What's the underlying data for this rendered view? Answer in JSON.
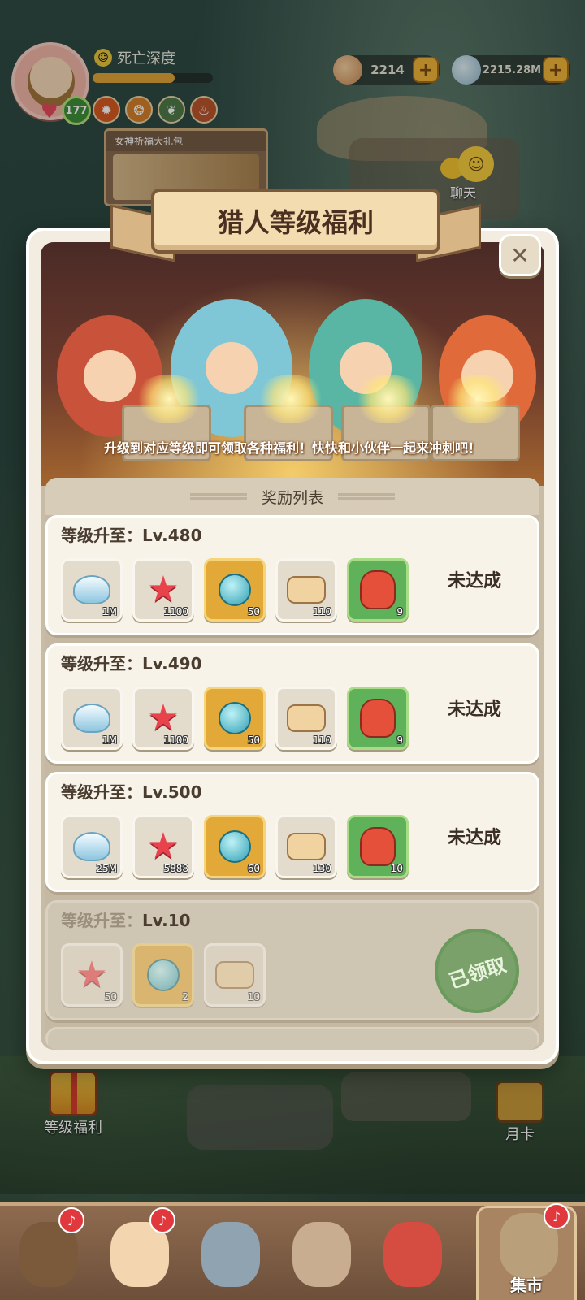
{
  "player": {
    "name": "死亡深度",
    "level": "177",
    "xp_progress_percent": 68
  },
  "currencies": [
    {
      "icon": "shell-coin-icon",
      "value": "2214"
    },
    {
      "icon": "pearl-shell-icon",
      "value": "2215.28M"
    }
  ],
  "gift_banner": {
    "title": "女神祈福大礼包"
  },
  "chat": {
    "label": "聊天"
  },
  "modal": {
    "title": "猎人等级福利",
    "caption": "升级到对应等级即可领取各种福利！快快和小伙伴一起来冲刺吧！",
    "close_symbol": "✕",
    "list_title": "奖励列表",
    "rows": [
      {
        "prefix": "等级升至：",
        "level": "Lv.480",
        "status": "未达成",
        "items": [
          {
            "icon": "shell-icon",
            "count": "1M"
          },
          {
            "icon": "starfish-icon",
            "count": "1100"
          },
          {
            "icon": "potion-icon",
            "count": "50"
          },
          {
            "icon": "bone-scroll-icon",
            "count": "110"
          },
          {
            "icon": "dino-egg-icon",
            "count": "9"
          }
        ]
      },
      {
        "prefix": "等级升至：",
        "level": "Lv.490",
        "status": "未达成",
        "items": [
          {
            "icon": "shell-icon",
            "count": "1M"
          },
          {
            "icon": "starfish-icon",
            "count": "1100"
          },
          {
            "icon": "potion-icon",
            "count": "50"
          },
          {
            "icon": "bone-scroll-icon",
            "count": "110"
          },
          {
            "icon": "dino-egg-icon",
            "count": "9"
          }
        ]
      },
      {
        "prefix": "等级升至：",
        "level": "Lv.500",
        "status": "未达成",
        "items": [
          {
            "icon": "shell-icon",
            "count": "25M"
          },
          {
            "icon": "starfish-icon",
            "count": "5888"
          },
          {
            "icon": "potion-icon",
            "count": "60"
          },
          {
            "icon": "bone-scroll-icon",
            "count": "130"
          },
          {
            "icon": "dino-egg-icon",
            "count": "10"
          }
        ]
      },
      {
        "prefix": "等级升至：",
        "level": "Lv.10",
        "status": "已领取",
        "items": [
          {
            "icon": "starfish-icon",
            "count": "50"
          },
          {
            "icon": "potion-icon",
            "count": "2"
          },
          {
            "icon": "bone-scroll-icon",
            "count": "10"
          }
        ]
      }
    ]
  },
  "side": {
    "level_benefit": "等级福利",
    "month_card": "月卡"
  },
  "bottom_nav": {
    "market": "集市"
  }
}
